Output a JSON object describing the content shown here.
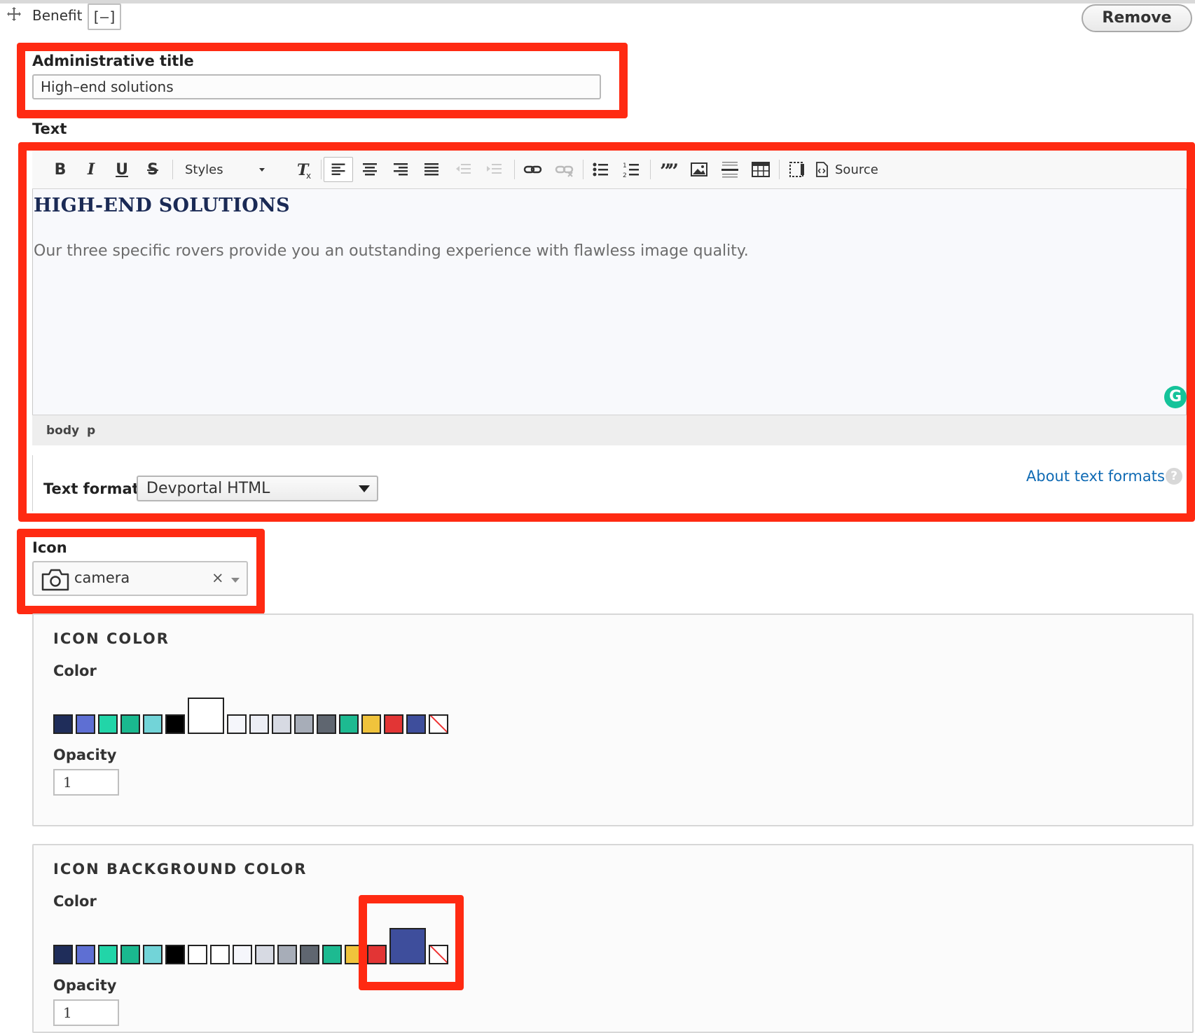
{
  "header": {
    "row_label": "Benefit",
    "collapse_label": "[–]",
    "remove_label": "Remove"
  },
  "admin_title": {
    "label": "Administrative title",
    "value": "High–end solutions"
  },
  "text_field": {
    "label": "Text",
    "toolbar": {
      "bold": "B",
      "italic": "I",
      "underline": "U",
      "strike": "S",
      "styles_label": "Styles",
      "source_label": "Source"
    },
    "content": {
      "heading": "HIGH-END SOLUTIONS",
      "paragraph": "Our three specific rovers provide you an outstanding experience with flawless image quality."
    },
    "path": [
      "body",
      "p"
    ],
    "format_label": "Text format",
    "format_value": "Devportal HTML",
    "about_link": "About text formats",
    "help_glyph": "?",
    "grammarly_glyph": "G"
  },
  "icon_field": {
    "label": "Icon",
    "value": "camera",
    "clear_glyph": "×",
    "icon_name": "camera-icon"
  },
  "icon_color": {
    "legend": "ICON COLOR",
    "color_label": "Color",
    "swatches": [
      "#1f2d5a",
      "#5e6fd3",
      "#22d5a8",
      "#1ab98f",
      "#72d4d8",
      "#000000",
      "#ffffff",
      "#f5f6fb",
      "#eceef5",
      "#d7dae3",
      "#a7adb8",
      "#5f6670",
      "#1dba91",
      "#f0c33c",
      "#e23535",
      "#3e4e9c",
      "none"
    ],
    "selected_index": 6,
    "opacity_label": "Opacity",
    "opacity_value": "1"
  },
  "icon_bg_color": {
    "legend": "ICON BACKGROUND COLOR",
    "color_label": "Color",
    "swatches": [
      "#1f2d5a",
      "#5e6fd3",
      "#22d5a8",
      "#1ab98f",
      "#72d4d8",
      "#000000",
      "#ffffff",
      "#ffffff",
      "#f5f6fb",
      "#d7dae3",
      "#a7adb8",
      "#5f6670",
      "#1dba91",
      "#f0c33c",
      "#e23535",
      "#3e4e9c",
      "none"
    ],
    "selected_index": 15,
    "opacity_label": "Opacity",
    "opacity_value": "1"
  },
  "colors": {
    "highlight": "#ff2a12",
    "link": "#0f6ab4",
    "heading": "#1a2a55"
  }
}
